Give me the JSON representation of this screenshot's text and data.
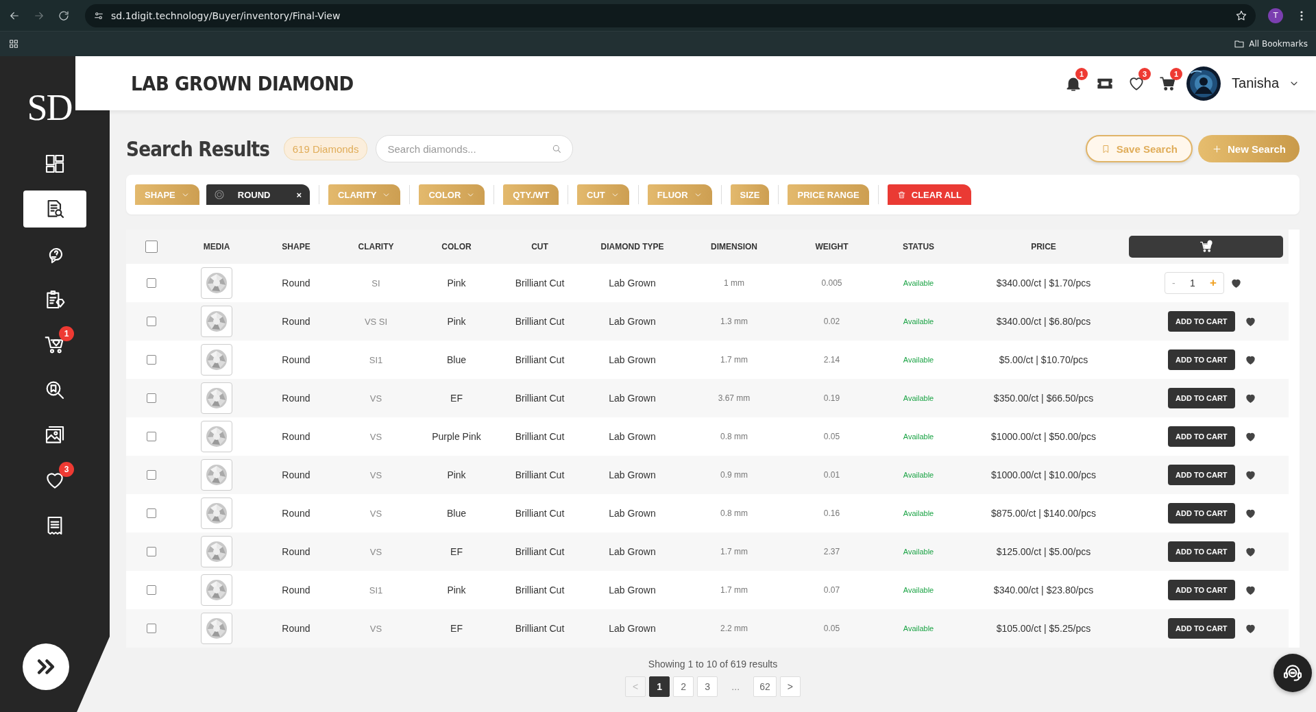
{
  "browser": {
    "url": "sd.1digit.technology/Buyer/inventory/Final-View",
    "profile": "T",
    "bookmarks_label": "All Bookmarks"
  },
  "sidebar": {
    "logo": "SD",
    "items": [
      {
        "selected": false
      },
      {
        "selected": true
      },
      {
        "selected": false
      },
      {
        "selected": false
      },
      {
        "selected": false,
        "badge": "1"
      },
      {
        "selected": false
      },
      {
        "selected": false
      },
      {
        "selected": false,
        "badge": "3"
      },
      {
        "selected": false
      }
    ]
  },
  "header": {
    "title": "LAB GROWN DIAMOND",
    "notification_badge": "1",
    "wishlist_badge": "3",
    "cart_badge": "1",
    "user": "Tanisha"
  },
  "toolbar": {
    "heading": "Search Results",
    "count": "619 Diamonds",
    "search": {
      "placeholder": "Search diamonds..."
    },
    "save_button": "Save Search",
    "new_button": "New Search"
  },
  "filters": [
    {
      "kind": "dropdown",
      "label": "SHAPE"
    },
    {
      "kind": "chip",
      "label": "ROUND",
      "close": "×"
    },
    {
      "kind": "dropdown",
      "label": "CLARITY"
    },
    {
      "kind": "dropdown",
      "label": "COLOR"
    },
    {
      "kind": "plain",
      "label": "QTY./WT"
    },
    {
      "kind": "dropdown",
      "label": "CUT"
    },
    {
      "kind": "dropdown",
      "label": "FLUOR"
    },
    {
      "kind": "plain",
      "label": "SIZE"
    },
    {
      "kind": "plain",
      "label": "PRICE RANGE"
    },
    {
      "kind": "clear",
      "label": "CLEAR ALL"
    }
  ],
  "table": {
    "columns": [
      "MEDIA",
      "SHAPE",
      "CLARITY",
      "COLOR",
      "CUT",
      "DIAMOND TYPE",
      "DIMENSION",
      "WEIGHT",
      "STATUS",
      "PRICE"
    ],
    "select_all": {
      "checked": false
    },
    "rows": [
      {
        "checked": false,
        "shape": "Round",
        "clarity": "SI",
        "stone_color": "Pink",
        "cut": "Brilliant Cut",
        "type": "Lab Grown",
        "dimension": "1 mm",
        "weight": "0.005",
        "status": "Available",
        "price": "$340.00/ct | $1.70/pcs",
        "kind": "stepper",
        "minus": "-",
        "qty": "1",
        "plus": "+"
      },
      {
        "checked": false,
        "shape": "Round",
        "clarity": "VS SI",
        "stone_color": "Pink",
        "cut": "Brilliant Cut",
        "type": "Lab Grown",
        "dimension": "1.3 mm",
        "weight": "0.02",
        "status": "Available",
        "price": "$340.00/ct | $6.80/pcs",
        "kind": "button",
        "button": "ADD TO CART"
      },
      {
        "checked": false,
        "shape": "Round",
        "clarity": "SI1",
        "stone_color": "Blue",
        "cut": "Brilliant Cut",
        "type": "Lab Grown",
        "dimension": "1.7 mm",
        "weight": "2.14",
        "status": "Available",
        "price": "$5.00/ct | $10.70/pcs",
        "kind": "button",
        "button": "ADD TO CART"
      },
      {
        "checked": false,
        "shape": "Round",
        "clarity": "VS",
        "stone_color": "EF",
        "cut": "Brilliant Cut",
        "type": "Lab Grown",
        "dimension": "3.67 mm",
        "weight": "0.19",
        "status": "Available",
        "price": "$350.00/ct | $66.50/pcs",
        "kind": "button",
        "button": "ADD TO CART"
      },
      {
        "checked": false,
        "shape": "Round",
        "clarity": "VS",
        "stone_color": "Purple Pink",
        "cut": "Brilliant Cut",
        "type": "Lab Grown",
        "dimension": "0.8 mm",
        "weight": "0.05",
        "status": "Available",
        "price": "$1000.00/ct | $50.00/pcs",
        "kind": "button",
        "button": "ADD TO CART"
      },
      {
        "checked": false,
        "shape": "Round",
        "clarity": "VS",
        "stone_color": "Pink",
        "cut": "Brilliant Cut",
        "type": "Lab Grown",
        "dimension": "0.9 mm",
        "weight": "0.01",
        "status": "Available",
        "price": "$1000.00/ct | $10.00/pcs",
        "kind": "button",
        "button": "ADD TO CART"
      },
      {
        "checked": false,
        "shape": "Round",
        "clarity": "VS",
        "stone_color": "Blue",
        "cut": "Brilliant Cut",
        "type": "Lab Grown",
        "dimension": "0.8 mm",
        "weight": "0.16",
        "status": "Available",
        "price": "$875.00/ct | $140.00/pcs",
        "kind": "button",
        "button": "ADD TO CART"
      },
      {
        "checked": false,
        "shape": "Round",
        "clarity": "VS",
        "stone_color": "EF",
        "cut": "Brilliant Cut",
        "type": "Lab Grown",
        "dimension": "1.7 mm",
        "weight": "2.37",
        "status": "Available",
        "price": "$125.00/ct | $5.00/pcs",
        "kind": "button",
        "button": "ADD TO CART"
      },
      {
        "checked": false,
        "shape": "Round",
        "clarity": "SI1",
        "stone_color": "Pink",
        "cut": "Brilliant Cut",
        "type": "Lab Grown",
        "dimension": "1.7 mm",
        "weight": "0.07",
        "status": "Available",
        "price": "$340.00/ct | $23.80/pcs",
        "kind": "button",
        "button": "ADD TO CART"
      },
      {
        "checked": false,
        "shape": "Round",
        "clarity": "VS",
        "stone_color": "EF",
        "cut": "Brilliant Cut",
        "type": "Lab Grown",
        "dimension": "2.2 mm",
        "weight": "0.05",
        "status": "Available",
        "price": "$105.00/ct | $5.25/pcs",
        "kind": "button",
        "button": "ADD TO CART"
      }
    ]
  },
  "pagination": {
    "summary": "Showing 1 to 10 of 619 results",
    "prev": "<",
    "pages": [
      {
        "label": "1",
        "selected": true
      },
      {
        "label": "2",
        "selected": false
      },
      {
        "label": "3",
        "selected": false
      },
      {
        "label": "...",
        "kind": "gap"
      },
      {
        "label": "62",
        "selected": false
      }
    ],
    "next": ">"
  }
}
